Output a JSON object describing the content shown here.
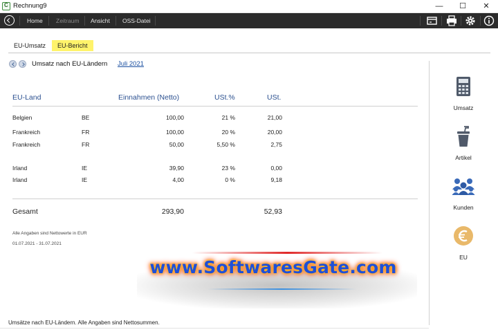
{
  "window": {
    "title": "Rechnung9"
  },
  "menu": {
    "items": [
      {
        "label": "Home",
        "enabled": true
      },
      {
        "label": "Zeitraum",
        "enabled": false
      },
      {
        "label": "Ansicht",
        "enabled": true
      },
      {
        "label": "OSS-Datei",
        "enabled": true
      }
    ],
    "tools": [
      "window-icon",
      "printer-icon",
      "gear-icon",
      "info-icon"
    ]
  },
  "tabs": [
    {
      "label": "EU-Umsatz",
      "active": false
    },
    {
      "label": "EU-Bericht",
      "active": true
    }
  ],
  "report": {
    "title": "Umsatz nach EU-Ländern",
    "period": "Juli 2021"
  },
  "table": {
    "headers": {
      "country": "EU-Land",
      "income": "Einnahmen (Netto)",
      "vat_rate": "USt.%",
      "vat": "USt."
    },
    "rows": [
      {
        "country": "Belgien",
        "code": "BE",
        "income": "100,00",
        "vat_rate": "21 %",
        "vat": "21,00"
      },
      {
        "country": "Frankreich",
        "code": "FR",
        "income": "100,00",
        "vat_rate": "20 %",
        "vat": "20,00"
      },
      {
        "country": "Frankreich",
        "code": "FR",
        "income": "50,00",
        "vat_rate": "5,50 %",
        "vat": "2,75"
      },
      {
        "country": "Irland",
        "code": "IE",
        "income": "39,90",
        "vat_rate": "23 %",
        "vat": "0,00"
      },
      {
        "country": "Irland",
        "code": "IE",
        "income": "4,00",
        "vat_rate": "0 %",
        "vat": "9,18"
      }
    ],
    "total": {
      "label": "Gesamt",
      "income": "293,90",
      "vat": "52,93"
    },
    "notes": [
      "Alle Angaben sind Nettowerte in EUR",
      "01.07.2021 - 31.07.2021"
    ]
  },
  "sidebar": [
    {
      "label": "Umsatz",
      "icon": "calculator-icon"
    },
    {
      "label": "Artikel",
      "icon": "cup-icon"
    },
    {
      "label": "Kunden",
      "icon": "people-icon"
    },
    {
      "label": "EU",
      "icon": "euro-icon"
    }
  ],
  "watermark": "www.SoftwaresGate.com",
  "status": "Umsätze nach EU-Ländern. Alle Angaben sind Nettosummen.",
  "colors": {
    "menubar": "#2b2b2b",
    "active_tab": "#fff36b",
    "header_text": "#2a4f8f",
    "link": "#1a4fa0",
    "sidebar_icon": "#505a6a",
    "euro_icon": "#e9b96a"
  }
}
